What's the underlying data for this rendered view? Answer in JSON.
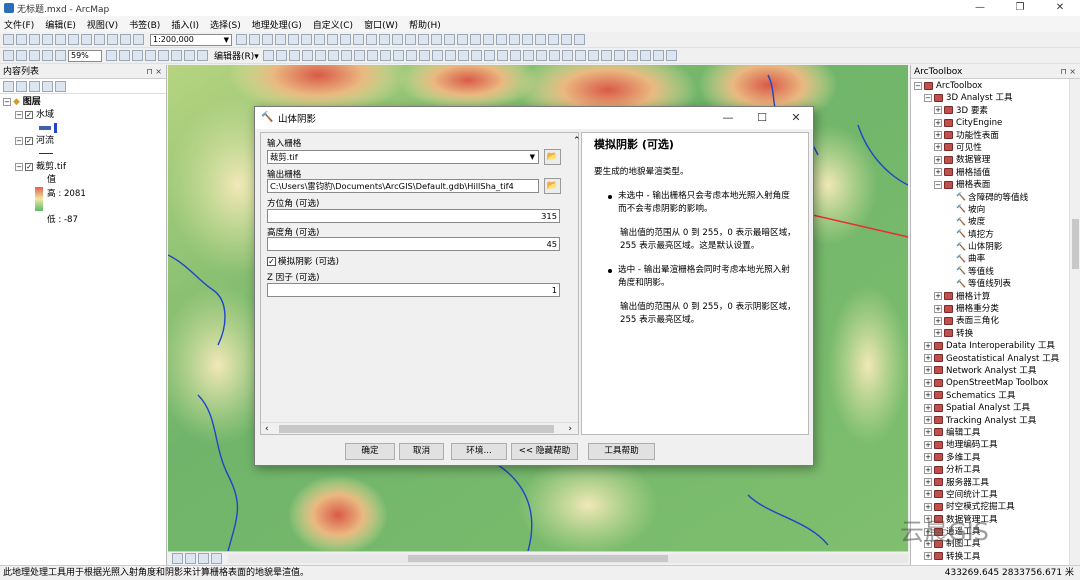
{
  "window": {
    "title": "无标题.mxd - ArcMap",
    "minimize": "—",
    "restore": "❐",
    "close": "✕"
  },
  "menu": [
    "文件(F)",
    "编辑(E)",
    "视图(V)",
    "书签(B)",
    "插入(I)",
    "选择(S)",
    "地理处理(G)",
    "自定义(C)",
    "窗口(W)",
    "帮助(H)"
  ],
  "toolbar": {
    "scale": "1:200,000",
    "zoom": "59%",
    "editor": "编辑器(R)▾"
  },
  "toc": {
    "header": "内容列表",
    "layers": {
      "root": "图层",
      "water": "水域",
      "river": "河流",
      "dem": "裁剪.tif",
      "value_label": "值",
      "high": "高 : 2081",
      "low": "低 : -87"
    }
  },
  "toolbox": {
    "header": "ArcToolbox",
    "root": "ArcToolbox",
    "items": [
      {
        "label": "3D Analyst 工具",
        "level": 1,
        "kind": "box",
        "exp": "−"
      },
      {
        "label": "3D 要素",
        "level": 2,
        "kind": "box",
        "exp": "+"
      },
      {
        "label": "CityEngine",
        "level": 2,
        "kind": "box",
        "exp": "+"
      },
      {
        "label": "功能性表面",
        "level": 2,
        "kind": "box",
        "exp": "+"
      },
      {
        "label": "可见性",
        "level": 2,
        "kind": "box",
        "exp": "+"
      },
      {
        "label": "数据管理",
        "level": 2,
        "kind": "box",
        "exp": "+"
      },
      {
        "label": "栅格插值",
        "level": 2,
        "kind": "box",
        "exp": "+"
      },
      {
        "label": "栅格表面",
        "level": 2,
        "kind": "box",
        "exp": "−"
      },
      {
        "label": "含障碍的等值线",
        "level": 3,
        "kind": "tool",
        "exp": ""
      },
      {
        "label": "坡向",
        "level": 3,
        "kind": "tool",
        "exp": ""
      },
      {
        "label": "坡度",
        "level": 3,
        "kind": "tool",
        "exp": ""
      },
      {
        "label": "填挖方",
        "level": 3,
        "kind": "tool",
        "exp": ""
      },
      {
        "label": "山体阴影",
        "level": 3,
        "kind": "tool",
        "exp": ""
      },
      {
        "label": "曲率",
        "level": 3,
        "kind": "tool",
        "exp": ""
      },
      {
        "label": "等值线",
        "level": 3,
        "kind": "tool",
        "exp": ""
      },
      {
        "label": "等值线列表",
        "level": 3,
        "kind": "tool",
        "exp": ""
      },
      {
        "label": "栅格计算",
        "level": 2,
        "kind": "box",
        "exp": "+"
      },
      {
        "label": "栅格重分类",
        "level": 2,
        "kind": "box",
        "exp": "+"
      },
      {
        "label": "表面三角化",
        "level": 2,
        "kind": "box",
        "exp": "+"
      },
      {
        "label": "转换",
        "level": 2,
        "kind": "box",
        "exp": "+"
      },
      {
        "label": "Data Interoperability 工具",
        "level": 1,
        "kind": "box",
        "exp": "+"
      },
      {
        "label": "Geostatistical Analyst 工具",
        "level": 1,
        "kind": "box",
        "exp": "+"
      },
      {
        "label": "Network Analyst 工具",
        "level": 1,
        "kind": "box",
        "exp": "+"
      },
      {
        "label": "OpenStreetMap Toolbox",
        "level": 1,
        "kind": "box",
        "exp": "+"
      },
      {
        "label": "Schematics 工具",
        "level": 1,
        "kind": "box",
        "exp": "+"
      },
      {
        "label": "Spatial Analyst 工具",
        "level": 1,
        "kind": "box",
        "exp": "+"
      },
      {
        "label": "Tracking Analyst 工具",
        "level": 1,
        "kind": "box",
        "exp": "+"
      },
      {
        "label": "编辑工具",
        "level": 1,
        "kind": "box",
        "exp": "+"
      },
      {
        "label": "地理编码工具",
        "level": 1,
        "kind": "box",
        "exp": "+"
      },
      {
        "label": "多维工具",
        "level": 1,
        "kind": "box",
        "exp": "+"
      },
      {
        "label": "分析工具",
        "level": 1,
        "kind": "box",
        "exp": "+"
      },
      {
        "label": "服务器工具",
        "level": 1,
        "kind": "box",
        "exp": "+"
      },
      {
        "label": "空间统计工具",
        "level": 1,
        "kind": "box",
        "exp": "+"
      },
      {
        "label": "时空模式挖掘工具",
        "level": 1,
        "kind": "box",
        "exp": "+"
      },
      {
        "label": "数据管理工具",
        "level": 1,
        "kind": "box",
        "exp": "+"
      },
      {
        "label": "逍遥工具",
        "level": 1,
        "kind": "box",
        "exp": "+"
      },
      {
        "label": "制图工具",
        "level": 1,
        "kind": "box",
        "exp": "+"
      },
      {
        "label": "转换工具",
        "level": 1,
        "kind": "box",
        "exp": "+"
      }
    ]
  },
  "dialog": {
    "title": "山体阴影",
    "input_label": "输入栅格",
    "input_value": "裁剪.tif",
    "output_label": "输出栅格",
    "output_value": "C:\\Users\\雷钧豹\\Documents\\ArcGIS\\Default.gdb\\HillSha_tif4",
    "azimuth_label": "方位角 (可选)",
    "azimuth_value": "315",
    "altitude_label": "高度角 (可选)",
    "altitude_value": "45",
    "model_shadows_label": "模拟阴影 (可选)",
    "zfactor_label": "Z 因子 (可选)",
    "zfactor_value": "1",
    "help": {
      "title": "模拟阴影 (可选)",
      "intro": "要生成的地貌晕渲类型。",
      "b1": "未选中 - 输出栅格只会考虑本地光照入射角度而不会考虑阴影的影响。",
      "p1": "输出值的范围从 0 到 255，0 表示最暗区域，255 表示最亮区域。这是默认设置。",
      "b2": "选中 - 输出晕渲栅格会同时考虑本地光照入射角度和阴影。",
      "p2": "输出值的范围从 0 到 255，0 表示阴影区域，255 表示最亮区域。"
    },
    "buttons": {
      "ok": "确定",
      "cancel": "取消",
      "env": "环境...",
      "hide_help": "<< 隐藏帮助",
      "tool_help": "工具帮助"
    }
  },
  "status": {
    "message": "此地理处理工具用于根据光照入射角度和阴影来计算栅格表面的地貌晕渲值。",
    "coords": "433269.645  2833756.671 米"
  },
  "watermark": "云晨GIS",
  "colors": {
    "dem_high": "#e06050",
    "dem_mid": "#f0e8a0",
    "dem_low": "#5cb86c",
    "river": "#1f45c8",
    "arrow": "#e83030",
    "toolbox_icon": "#c0504d"
  }
}
